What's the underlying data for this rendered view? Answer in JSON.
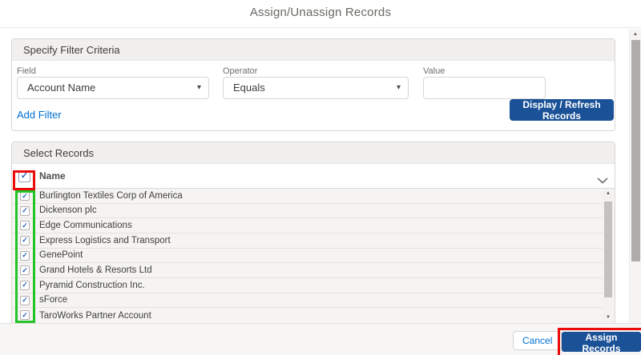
{
  "title": "Assign/Unassign Records",
  "filter": {
    "section_title": "Specify Filter Criteria",
    "field_label": "Field",
    "field_value": "Account Name",
    "operator_label": "Operator",
    "operator_value": "Equals",
    "value_label": "Value",
    "value_text": "",
    "add_filter": "Add Filter",
    "refresh_button": "Display / Refresh Records"
  },
  "records": {
    "section_title": "Select Records",
    "name_header": "Name",
    "header_checkbox_checked": true,
    "rows": [
      {
        "name": "Burlington Textiles Corp of America",
        "checked": true
      },
      {
        "name": "Dickenson plc",
        "checked": true
      },
      {
        "name": "Edge Communications",
        "checked": true
      },
      {
        "name": "Express Logistics and Transport",
        "checked": true
      },
      {
        "name": "GenePoint",
        "checked": true
      },
      {
        "name": "Grand Hotels & Resorts Ltd",
        "checked": true
      },
      {
        "name": "Pyramid Construction Inc.",
        "checked": true
      },
      {
        "name": "sForce",
        "checked": true
      },
      {
        "name": "TaroWorks Partner Account",
        "checked": true
      }
    ]
  },
  "footer": {
    "cancel": "Cancel",
    "assign": "Assign Records"
  },
  "icons": {
    "checkmark": "✓",
    "dropdown_arrow": "▾",
    "scroll_up": "▲",
    "scroll_down": "▼"
  },
  "colors": {
    "primary_button": "#1b5297",
    "link_blue": "#0070d2",
    "annotation_red": "#ea0b0b",
    "annotation_green": "#24c326",
    "checkmark_blue": "#2563b8"
  }
}
